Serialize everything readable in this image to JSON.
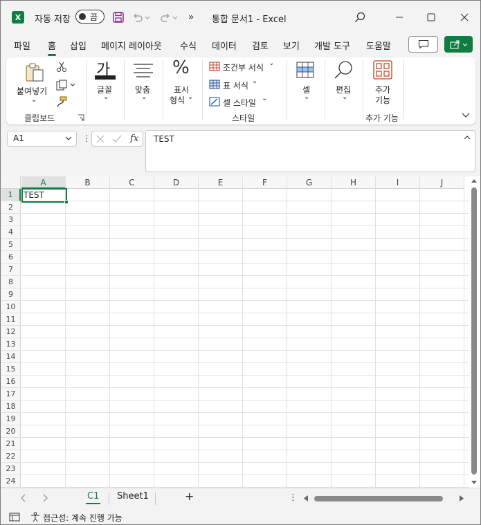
{
  "titlebar": {
    "app_logo": "X",
    "autosave_label": "자동 저장",
    "autosave_state": "끔",
    "more_label": "»",
    "doc_title": "통합 문서1  -  Excel"
  },
  "menu": {
    "tabs": [
      {
        "label": "파일"
      },
      {
        "label": "홈"
      },
      {
        "label": "삽입"
      },
      {
        "label": "페이지 레이아웃"
      },
      {
        "label": "수식"
      },
      {
        "label": "데이터"
      },
      {
        "label": "검토"
      },
      {
        "label": "보기"
      },
      {
        "label": "개발 도구"
      },
      {
        "label": "도움말"
      }
    ],
    "active_tab": "홈"
  },
  "ribbon": {
    "clipboard": {
      "paste": "붙여넣기",
      "group": "클립보드"
    },
    "font": {
      "glyph": "가",
      "label": "글꼴"
    },
    "align": {
      "label": "맞춤"
    },
    "number": {
      "glyph": "%",
      "label1": "표시",
      "label2": "형식"
    },
    "styles": {
      "conditional": "조건부 서식",
      "table": "표 서식",
      "cell_style": "셀 스타일",
      "group": "스타일"
    },
    "cells": {
      "label": "셀"
    },
    "editing": {
      "label": "편집"
    },
    "addins": {
      "label1": "추가",
      "label2": "기능",
      "group": "추가 기능"
    }
  },
  "formula_bar": {
    "name_box": "A1",
    "fx": "fx",
    "value": "TEST"
  },
  "grid": {
    "columns": [
      "A",
      "B",
      "C",
      "D",
      "E",
      "F",
      "G",
      "H",
      "I",
      "J"
    ],
    "rows": [
      "1",
      "2",
      "3",
      "4",
      "5",
      "6",
      "7",
      "8",
      "9",
      "10",
      "11",
      "12",
      "13",
      "14",
      "15",
      "16",
      "17",
      "18",
      "19",
      "20",
      "21",
      "22",
      "23",
      "24"
    ],
    "active_cell": "A1",
    "a1_value": "TEST"
  },
  "sheets": {
    "tabs": [
      "C1",
      "Sheet1"
    ],
    "active": "C1",
    "add": "+"
  },
  "status": {
    "accessibility": "접근성: 계속 진행 가능"
  },
  "colors": {
    "accent": "#107c41",
    "conditional_red": "#c43e1c",
    "cell_blue": "#2b5797"
  }
}
